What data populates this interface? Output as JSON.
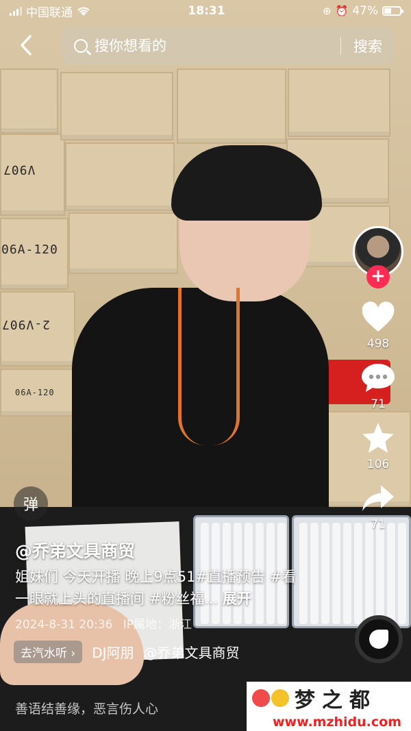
{
  "status_bar": {
    "carrier": "中国联通",
    "time": "18:31",
    "battery": "47%",
    "battery_level": 0.47
  },
  "top_bar": {
    "search_placeholder": "搜你想看的",
    "search_button": "搜索"
  },
  "right_rail": {
    "like_count": "498",
    "comment_count": "71",
    "favorite_count": "106",
    "share_count": "71",
    "follow_symbol": "+"
  },
  "danmu_label": "弹",
  "post": {
    "author": "@乔弟文具商贸",
    "caption": "姐妹们 今天开播 晚上9点51#直播预告 #看一眼就上头的直播间 #粉丝福...",
    "expand": "展开",
    "date": "2024-8-31 20:36",
    "ip": "IP属地：浙江",
    "music_chip": "去汽水听",
    "music_name": "DJ阿朋",
    "music_author": "@乔弟文具商贸",
    "comment_prompt": "善语结善缘，恶言伤人心"
  },
  "box_labels": [
    "V907",
    "06A-120",
    "2-V907",
    "06A-120"
  ],
  "watermark": {
    "title": "梦之都",
    "url": "www.mzhidu.com"
  },
  "colors": {
    "like_red": "#fe2c55",
    "lanyard": "#e0742e",
    "watermark_url": "#e22222"
  },
  "icons": [
    "back-icon",
    "search-icon",
    "heart-icon",
    "comment-icon",
    "star-icon",
    "share-icon",
    "music-disc-icon",
    "wifi-icon",
    "battery-icon"
  ]
}
